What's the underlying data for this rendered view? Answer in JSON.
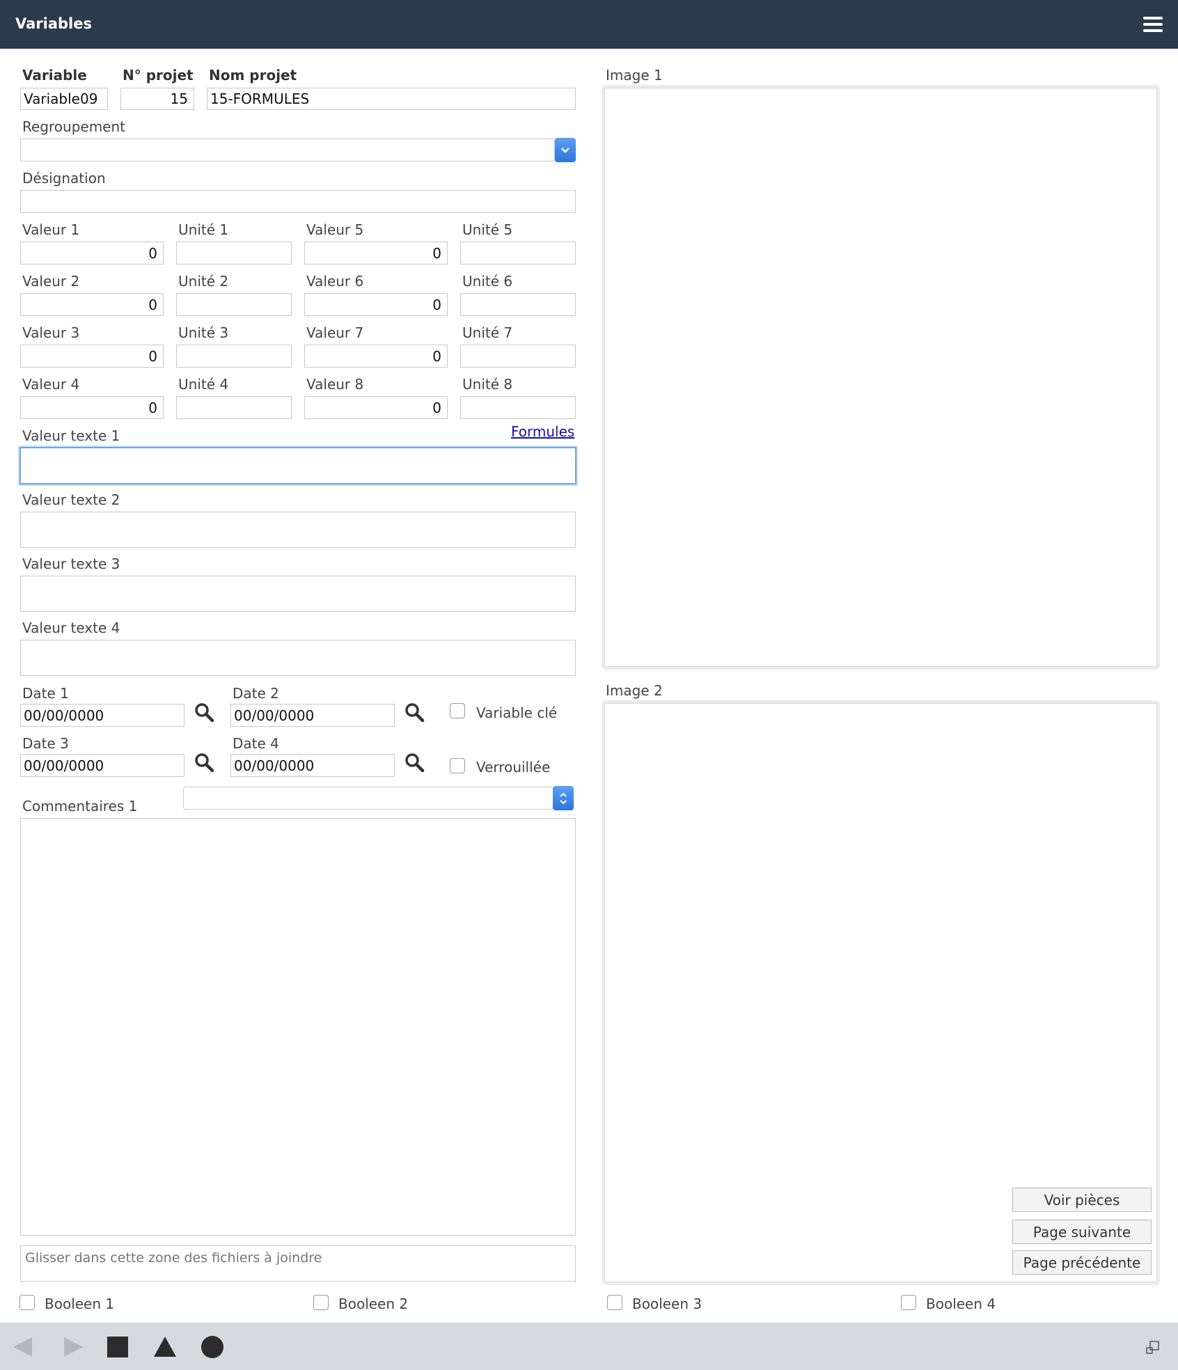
{
  "window": {
    "title": "Variables"
  },
  "header": {
    "variable_label": "Variable",
    "variable_value": "Variable09",
    "projet_num_label": "N° projet",
    "projet_num_value": "15",
    "projet_nom_label": "Nom projet",
    "projet_nom_value": "15-FORMULES"
  },
  "regroupement": {
    "label": "Regroupement",
    "value": ""
  },
  "designation": {
    "label": "Désignation",
    "value": ""
  },
  "valeurs": [
    {
      "label": "Valeur 1",
      "value": "0"
    },
    {
      "label": "Valeur 2",
      "value": "0"
    },
    {
      "label": "Valeur 3",
      "value": "0"
    },
    {
      "label": "Valeur 4",
      "value": "0"
    },
    {
      "label": "Valeur 5",
      "value": "0"
    },
    {
      "label": "Valeur 6",
      "value": "0"
    },
    {
      "label": "Valeur 7",
      "value": "0"
    },
    {
      "label": "Valeur 8",
      "value": "0"
    }
  ],
  "unites": [
    {
      "label": "Unité 1",
      "value": ""
    },
    {
      "label": "Unité 2",
      "value": ""
    },
    {
      "label": "Unité 3",
      "value": ""
    },
    {
      "label": "Unité 4",
      "value": ""
    },
    {
      "label": "Unité 5",
      "value": ""
    },
    {
      "label": "Unité 6",
      "value": ""
    },
    {
      "label": "Unité 7",
      "value": ""
    },
    {
      "label": "Unité 8",
      "value": ""
    }
  ],
  "formules_link": "Formules",
  "textes": [
    {
      "label": "Valeur texte 1",
      "value": ""
    },
    {
      "label": "Valeur texte 2",
      "value": ""
    },
    {
      "label": "Valeur texte 3",
      "value": ""
    },
    {
      "label": "Valeur texte 4",
      "value": ""
    }
  ],
  "dates": [
    {
      "label": "Date 1",
      "value": "00/00/0000"
    },
    {
      "label": "Date 2",
      "value": "00/00/0000"
    },
    {
      "label": "Date 3",
      "value": "00/00/0000"
    },
    {
      "label": "Date 4",
      "value": "00/00/0000"
    }
  ],
  "checks": {
    "variable_cle": "Variable clé",
    "verrouillee": "Verrouillée"
  },
  "commentaires": {
    "label": "Commentaires 1",
    "value": "",
    "select_value": ""
  },
  "dropzone_placeholder": "Glisser dans cette zone des fichiers à joindre",
  "booleens": [
    "Booleen 1",
    "Booleen 2",
    "Booleen 3",
    "Booleen 4"
  ],
  "images": {
    "image1_label": "Image 1",
    "image2_label": "Image 2"
  },
  "buttons": {
    "voir_pieces": "Voir pièces",
    "page_suivante": "Page suivante",
    "page_precedente": "Page précédente"
  },
  "colors": {
    "header_bg": "#2c3b4b",
    "accent": "#2f76db",
    "toolbar_bg": "#d6d9de"
  }
}
